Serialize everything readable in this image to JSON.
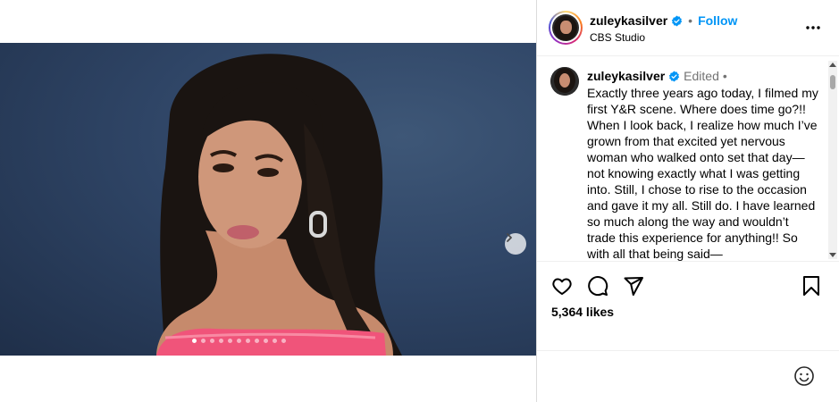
{
  "post": {
    "username": "zuleykasilver",
    "follow_label": "Follow",
    "location": "CBS Studio",
    "separator": "•",
    "edited_label": "Edited",
    "caption": "Exactly three years ago today, I filmed my first Y&R scene. Where does time go?!! When I look back, I realize how much I’ve grown from that excited yet nervous woman who walked onto set that day—not knowing exactly what I was getting into. Still, I chose to rise to the occasion and gave it my all. Still do. I have learned so much along the way and wouldn’t trade this experience for anything!! So with all that being said—",
    "likes": "5,364 likes"
  },
  "media": {
    "carousel_dots": 11,
    "active_dot": 0
  },
  "colors": {
    "follow": "#0095f6",
    "verified": "#0095f6",
    "background": "#2f4566",
    "dress": "#f0547a"
  },
  "icons": {
    "more": "more-options-icon",
    "like": "heart-icon",
    "comment": "comment-icon",
    "share": "share-icon",
    "save": "bookmark-icon",
    "emoji": "emoji-icon",
    "next": "chevron-right-icon",
    "verified": "verified-badge-icon"
  }
}
